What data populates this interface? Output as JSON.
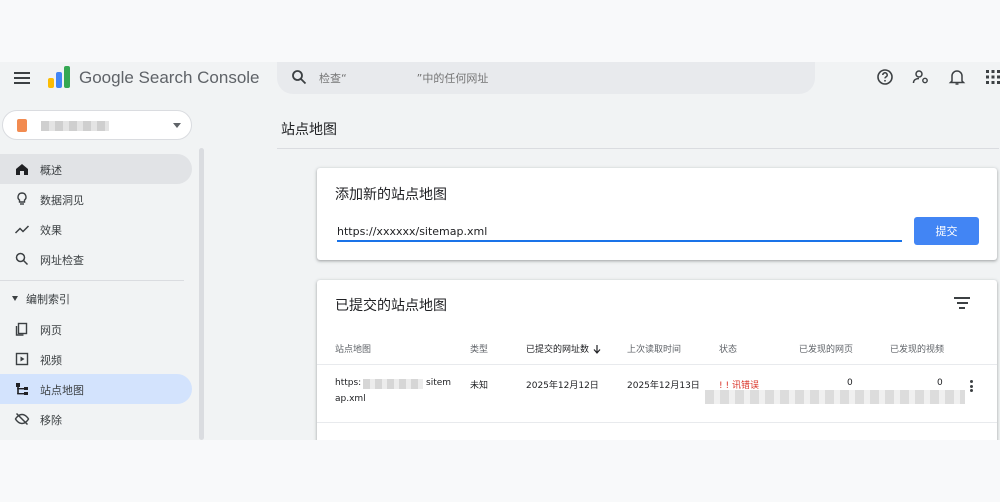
{
  "header": {
    "app_title": "Google Search Console",
    "search": {
      "placeholder": "检查“                    ”中的任何网址"
    },
    "icons": [
      "help-icon",
      "manage-users-icon",
      "notifications-icon",
      "apps-grid-icon"
    ],
    "logo_colors": [
      "#fbbc04",
      "#4285f4",
      "#34a853"
    ]
  },
  "sidebar": {
    "property_color": "#f28b50",
    "items": [
      {
        "label": "概述",
        "icon": "home-icon"
      },
      {
        "label": "数据洞见",
        "icon": "lightbulb-icon"
      },
      {
        "label": "效果",
        "icon": "trending-icon"
      },
      {
        "label": "网址检查",
        "icon": "search-icon"
      }
    ],
    "section_label": "编制索引",
    "section_items": [
      {
        "label": "网页",
        "icon": "pages-icon"
      },
      {
        "label": "视频",
        "icon": "video-icon"
      },
      {
        "label": "站点地图",
        "icon": "sitemap-icon"
      },
      {
        "label": "移除",
        "icon": "removal-icon"
      }
    ]
  },
  "main": {
    "page_title": "站点地图",
    "add_card": {
      "title": "添加新的站点地图",
      "url_value": "https://xxxxxx/sitemap.xml",
      "submit_label": "提交"
    },
    "list_card": {
      "title": "已提交的站点地图",
      "columns": [
        "站点地图",
        "类型",
        "已提交的网址数",
        "上次读取时间",
        "状态",
        "已发现的网页",
        "已发现的视频"
      ],
      "rows": [
        {
          "sitemap_prefix": "https:",
          "sitemap_suffix": "sitem",
          "sitemap_line2": "ap.xml",
          "type": "未知",
          "submitted": "2025年12月12日",
          "last_read": "2025年12月13日",
          "status": "!   !  讯错误",
          "pages": "0",
          "videos": "0"
        }
      ]
    }
  },
  "colors": {
    "accent": "#1a73e8",
    "selected_blue": "#d3e3fd",
    "error": "#d93025"
  }
}
